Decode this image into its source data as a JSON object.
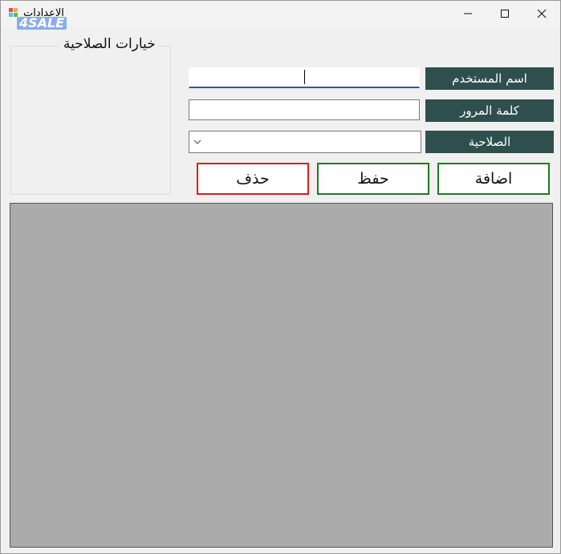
{
  "window": {
    "title": "الاعدادات",
    "watermark": "4SALE"
  },
  "group": {
    "title": "خيارات الصلاحية"
  },
  "form": {
    "username_label": "اسم المستخدم",
    "password_label": "كلمة المرور",
    "role_label": "الصلاحية",
    "username_value": "",
    "password_value": "",
    "role_selected": ""
  },
  "buttons": {
    "add": "اضافة",
    "save": "حفظ",
    "delete": "حذف"
  },
  "colors": {
    "label_bg": "#2f4f4f",
    "add_border": "#1e7a1e",
    "save_border": "#1e7a1e",
    "delete_border": "#d42020",
    "grid_bg": "#ababab"
  }
}
